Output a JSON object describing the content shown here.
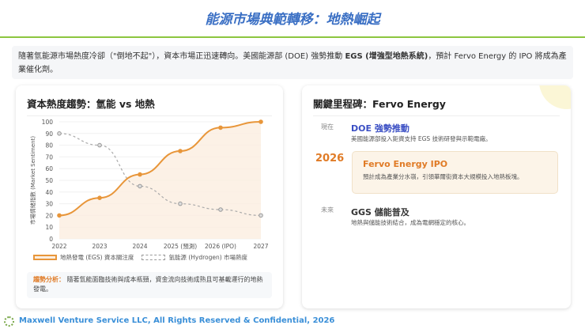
{
  "header": {
    "title": "能源市場典範轉移：地熱崛起"
  },
  "intro": {
    "text": "隨著氫能源市場熱度冷卻（\"倒地不起\"），資本市場正迅速轉向。美國能源部 (DOE) 強勢推動 ",
    "bold": "EGS (增強型地熱系統)",
    "text2": "，預計 Fervo Energy 的 IPO 將成為產業催化劑。"
  },
  "left_card": {
    "title": "資本熱度趨勢：氫能 vs 地熱",
    "analysis_label": "趨勢分析：",
    "analysis_text": "隨著氫能面臨技術與成本瓶頸，資金流向技術成熟且可基載運行的地熱發電。"
  },
  "chart_data": {
    "type": "line",
    "categories": [
      "2022",
      "2023",
      "2024",
      "2025 (預測)",
      "2026 (IPO)",
      "2027"
    ],
    "ylabel": "市場情緒指數 (Market Sentiment)",
    "ylim": [
      0,
      100
    ],
    "yticks": [
      0,
      10,
      20,
      30,
      40,
      50,
      60,
      70,
      80,
      90,
      100
    ],
    "legend_position": "bottom",
    "series": [
      {
        "name": "地熱發電 (EGS) 資本關注度",
        "values": [
          20,
          35,
          55,
          75,
          95,
          100
        ],
        "color": "#e8963a"
      },
      {
        "name": "氫能源 (Hydrogen) 市場熱度",
        "values": [
          90,
          80,
          45,
          30,
          25,
          20
        ],
        "color": "#aaaaaa"
      }
    ]
  },
  "right_card": {
    "title": "關鍵里程碑：Fervo Energy",
    "milestones": [
      {
        "label": "現在",
        "heading": "DOE 強勢推動",
        "desc": "美國能源部投入鉅資支持 EGS 技術研發與示範電廠。"
      },
      {
        "label": "2026",
        "heading": "Fervo Energy IPO",
        "desc": "預計成為產業分水嶺，引領華爾街資本大規模投入地熱板塊。"
      },
      {
        "label": "未來",
        "heading": "GGS 儲能普及",
        "desc": "地熱與儲能技術結合，成為電網穩定的核心。"
      }
    ]
  },
  "footer": {
    "text": "Maxwell Venture Service LLC, All Rights Reserved & Confidential, 2026"
  }
}
